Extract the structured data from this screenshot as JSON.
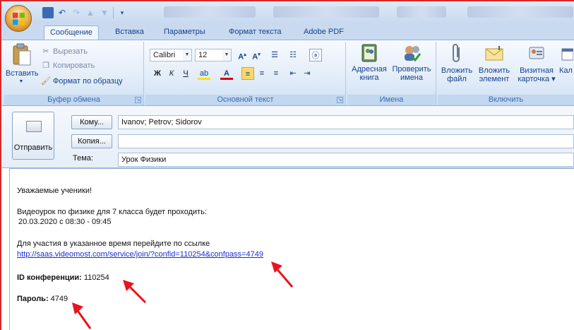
{
  "window": {
    "quick_access": [
      "save-icon",
      "undo-icon",
      "redo-icon",
      "up-arrow-icon",
      "down-arrow-icon",
      "customize-icon"
    ]
  },
  "tabs": [
    {
      "label": "Сообщение",
      "active": true
    },
    {
      "label": "Вставка",
      "active": false
    },
    {
      "label": "Параметры",
      "active": false
    },
    {
      "label": "Формат текста",
      "active": false
    },
    {
      "label": "Adobe PDF",
      "active": false
    }
  ],
  "ribbon": {
    "clipboard": {
      "paste": "Вставить",
      "cut": "Вырезать",
      "copy": "Копировать",
      "format_painter": "Формат по образцу",
      "group_label": "Буфер обмена"
    },
    "basic_text": {
      "font": "Calibri",
      "size": "12",
      "bold": "Ж",
      "italic": "К",
      "underline": "Ч",
      "group_label": "Основной текст"
    },
    "names": {
      "address_book_line1": "Адресная",
      "address_book_line2": "книга",
      "check_names_line1": "Проверить",
      "check_names_line2": "имена",
      "group_label": "Имена"
    },
    "include": {
      "attach_file_line1": "Вложить",
      "attach_file_line2": "файл",
      "attach_item_line1": "Вложить",
      "attach_item_line2": "элемент",
      "business_card_line1": "Визитная",
      "business_card_line2": "карточка",
      "calendar_partial": "Кал",
      "group_label": "Включить"
    }
  },
  "compose": {
    "send_label": "Отправить",
    "to_button": "Кому...",
    "to_value": "Ivanov; Petrov; Sidorov",
    "cc_button": "Копия...",
    "cc_value": "",
    "subject_label": "Тема:",
    "subject_value": "Урок Физики"
  },
  "message": {
    "greeting": "Уважаемые ученики!",
    "line1": "Видеоурок по физике для 7 класса будет проходить:",
    "line2": "20.03.2020 с 08:30 - 09:45",
    "line3": "Для участия в указанное время перейдите по ссылке",
    "link": "http://saas.videomost.com/service/join/?confid=110254&confpass=4749",
    "conf_id_label": "ID конференции:",
    "conf_id_value": "110254",
    "password_label": "Пароль:",
    "password_value": "4749"
  },
  "colors": {
    "annotation_arrow": "#e8141e",
    "link": "#1a2fd0",
    "ribbon_text": "#15428b"
  }
}
